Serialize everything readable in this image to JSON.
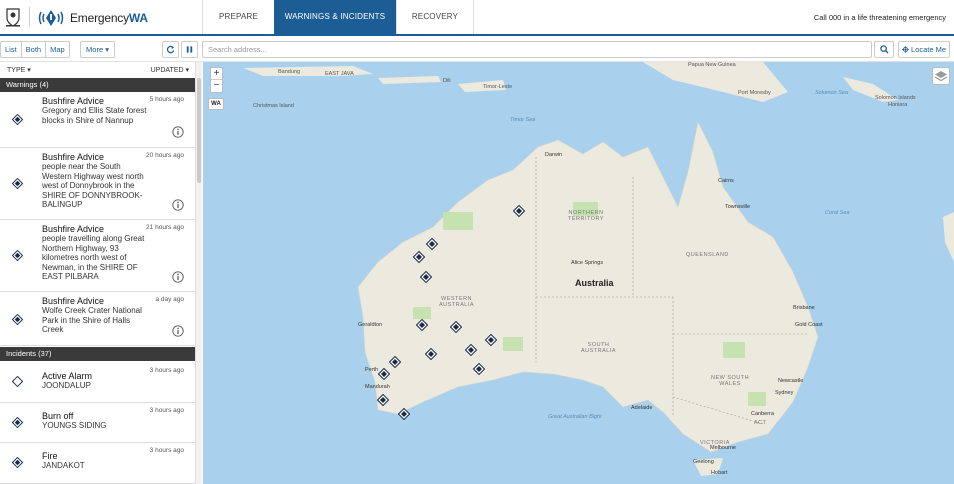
{
  "header": {
    "brand_prefix": "Emergency",
    "brand_suffix": "WA",
    "tabs": [
      {
        "label": "PREPARE",
        "active": false
      },
      {
        "label": "WARNINGS & INCIDENTS",
        "active": true
      },
      {
        "label": "RECOVERY",
        "active": false
      }
    ],
    "call_text": "Call 000 in a life threatening emergency",
    "accent_color": "#1d5d96"
  },
  "toolbar": {
    "view_modes": [
      "List",
      "Both",
      "Map"
    ],
    "more_label": "More ▾",
    "refresh_icon": "refresh-icon",
    "pause_icon": "pause-icon",
    "search_placeholder": "Search address...",
    "search_icon": "search-icon",
    "locate_label": "Locate Me"
  },
  "sidebar": {
    "sort_type": "TYPE ▾",
    "sort_updated": "UPDATED ▾",
    "warnings_header": "Warnings (4)",
    "warnings": [
      {
        "title": "Bushfire Advice",
        "desc": "Gregory and Ellis State forest blocks in Shire of Nannup",
        "time": "5 hours ago"
      },
      {
        "title": "Bushfire Advice",
        "desc": "people near the South Western Highway west north west of Donnybrook in the SHIRE OF DONNYBROOK-BALINGUP",
        "time": "20 hours ago"
      },
      {
        "title": "Bushfire Advice",
        "desc": "people travelling along Great Northern Highway, 93 kilometres north west of Newman, in the SHIRE OF EAST PILBARA",
        "time": "21 hours ago"
      },
      {
        "title": "Bushfire Advice",
        "desc": "Wolfe Creek Crater National Park in the Shire of Halls Creek",
        "time": "a day ago"
      }
    ],
    "incidents_header": "Incidents (37)",
    "incidents": [
      {
        "title": "Active Alarm",
        "desc": "JOONDALUP",
        "time": "3 hours ago",
        "style": "outline"
      },
      {
        "title": "Burn off",
        "desc": "YOUNGS SIDING",
        "time": "3 hours ago",
        "style": "solid"
      },
      {
        "title": "Fire",
        "desc": "JANDAKOT",
        "time": "3 hours ago",
        "style": "solid"
      }
    ]
  },
  "map": {
    "zoom_in": "+",
    "zoom_out": "−",
    "wa_button": "WA",
    "country_label": "Australia",
    "states": [
      {
        "name": "NORTHERN\nTERRITORY"
      },
      {
        "name": "QUEENSLAND"
      },
      {
        "name": "WESTERN\nAUSTRALIA"
      },
      {
        "name": "SOUTH\nAUSTRALIA"
      },
      {
        "name": "NEW SOUTH\nWALES"
      },
      {
        "name": "VICTORIA"
      },
      {
        "name": "ACT"
      }
    ],
    "seas": [
      "Timor Sea",
      "Coral Sea",
      "Great Australian Bight"
    ],
    "places": [
      "Bandung",
      "EAST JAVA",
      "Dili",
      "Timor-Leste",
      "Papua New Guinea",
      "Port Moresby",
      "Solomon Sea",
      "Solomon Islands",
      "Honiara",
      "Christmas Island",
      "Darwin",
      "Cairns",
      "Townsville",
      "Alice Springs",
      "Geraldton",
      "Perth",
      "Mandurah",
      "Brisbane",
      "Gold Coast",
      "Newcastle",
      "Sydney",
      "Canberra",
      "Melbourne",
      "Adelaide",
      "Hobart",
      "Geelong"
    ],
    "colors": {
      "water": "#a9d1ee",
      "land": "#ece9df",
      "park": "#c7e2b1"
    }
  }
}
